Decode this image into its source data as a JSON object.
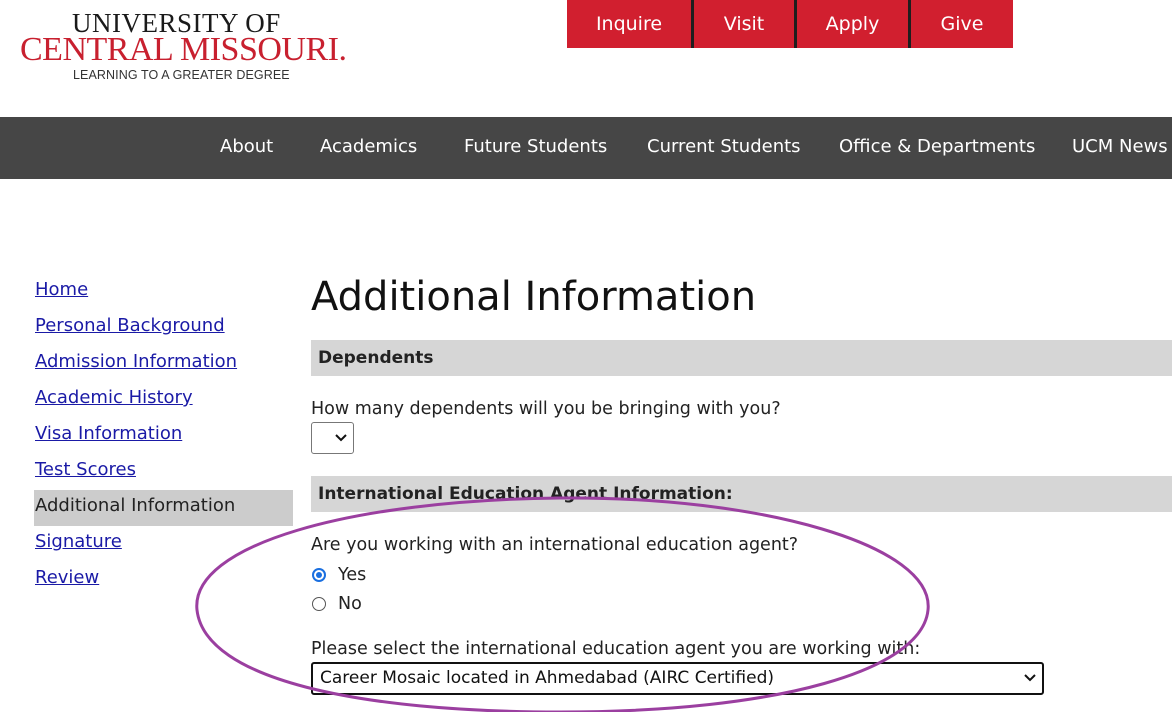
{
  "logo": {
    "line1": "UNIVERSITY OF",
    "line2": "CENTRAL MISSOURI.",
    "tagline": "LEARNING TO A GREATER DEGREE"
  },
  "top_actions": [
    "Inquire",
    "Visit",
    "Apply",
    "Give"
  ],
  "main_nav": [
    "About",
    "Academics",
    "Future Students",
    "Current Students",
    "Office & Departments",
    "UCM News"
  ],
  "sidebar": {
    "items": [
      {
        "label": "Home"
      },
      {
        "label": "Personal Background"
      },
      {
        "label": "Admission Information"
      },
      {
        "label": "Academic History"
      },
      {
        "label": "Visa Information"
      },
      {
        "label": "Test Scores"
      },
      {
        "label": "Additional Information",
        "active": true
      },
      {
        "label": "Signature"
      },
      {
        "label": "Review"
      }
    ]
  },
  "page": {
    "title": "Additional Information",
    "dependents": {
      "header": "Dependents",
      "question": "How many dependents will you be bringing with you?",
      "selected_value": ""
    },
    "agent": {
      "header": "International Education Agent Information:",
      "question": "Are you working with an international education agent?",
      "options": [
        "Yes",
        "No"
      ],
      "selected": "Yes",
      "select_label": "Please select the international education agent you are working with:",
      "select_value": "Career Mosaic located in Ahmedabad (AIRC Certified)"
    }
  },
  "colors": {
    "brand_red": "#d11f2f",
    "nav_bg": "#464646",
    "section_bg": "#d6d6d6",
    "annotation": "#9b3fa0"
  }
}
